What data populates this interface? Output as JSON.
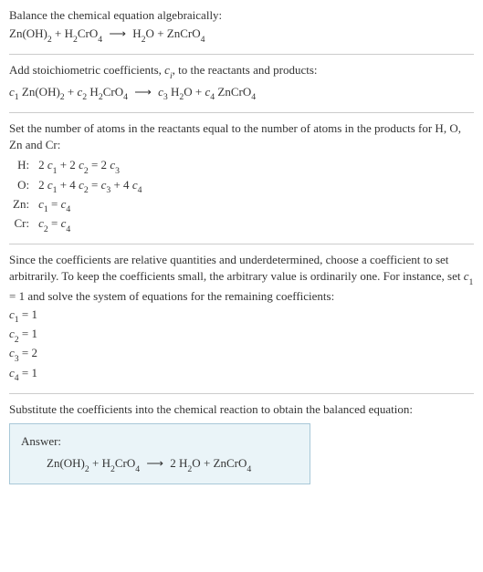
{
  "section1": {
    "heading": "Balance the chemical equation algebraically:",
    "lhs1": "Zn(OH)",
    "lhs1_sub": "2",
    "plus": " + ",
    "lhs2a": "H",
    "lhs2a_sub": "2",
    "lhs2b": "CrO",
    "lhs2b_sub": "4",
    "arrow": "⟶",
    "rhs1a": "H",
    "rhs1a_sub": "2",
    "rhs1b": "O",
    "plus2": " + ",
    "rhs2a": "ZnCrO",
    "rhs2a_sub": "4"
  },
  "section2": {
    "heading_a": "Add stoichiometric coefficients, ",
    "heading_c": "c",
    "heading_i": "i",
    "heading_b": ", to the reactants and products:",
    "c1": "c",
    "s1": "1",
    "sp1": " Zn(OH)",
    "sp1_sub": "2",
    "plus": " + ",
    "c2": "c",
    "s2": "2",
    "sp2a": " H",
    "sp2a_sub": "2",
    "sp2b": "CrO",
    "sp2b_sub": "4",
    "arrow": "⟶",
    "c3": "c",
    "s3": "3",
    "sp3a": " H",
    "sp3a_sub": "2",
    "sp3b": "O",
    "plus2": " + ",
    "c4": "c",
    "s4": "4",
    "sp4a": " ZnCrO",
    "sp4a_sub": "4"
  },
  "section3": {
    "heading": "Set the number of atoms in the reactants equal to the number of atoms in the products for H, O, Zn and Cr:",
    "rows": {
      "h_label": "H:",
      "h_eq_a": "2 ",
      "h_c1": "c",
      "h_s1": "1",
      "h_eq_b": " + 2 ",
      "h_c2": "c",
      "h_s2": "2",
      "h_eq_c": " = 2 ",
      "h_c3": "c",
      "h_s3": "3",
      "o_label": "O:",
      "o_eq_a": "2 ",
      "o_c1": "c",
      "o_s1": "1",
      "o_eq_b": " + 4 ",
      "o_c2": "c",
      "o_s2": "2",
      "o_eq_c": " = ",
      "o_c3": "c",
      "o_s3": "3",
      "o_eq_d": " + 4 ",
      "o_c4": "c",
      "o_s4": "4",
      "zn_label": "Zn:",
      "zn_c1": "c",
      "zn_s1": "1",
      "zn_eq": " = ",
      "zn_c4": "c",
      "zn_s4": "4",
      "cr_label": "Cr:",
      "cr_c2": "c",
      "cr_s2": "2",
      "cr_eq": " = ",
      "cr_c4": "c",
      "cr_s4": "4"
    }
  },
  "section4": {
    "text_a": "Since the coefficients are relative quantities and underdetermined, choose a coefficient to set arbitrarily. To keep the coefficients small, the arbitrary value is ordinarily one. For instance, set ",
    "c1": "c",
    "s1": "1",
    "text_b": " = 1 and solve the system of equations for the remaining coefficients:",
    "l1a": "c",
    "l1s": "1",
    "l1b": " = 1",
    "l2a": "c",
    "l2s": "2",
    "l2b": " = 1",
    "l3a": "c",
    "l3s": "3",
    "l3b": " = 2",
    "l4a": "c",
    "l4s": "4",
    "l4b": " = 1"
  },
  "section5": {
    "heading": "Substitute the coefficients into the chemical reaction to obtain the balanced equation:",
    "answer_label": "Answer:",
    "lhs1": "Zn(OH)",
    "lhs1_sub": "2",
    "plus": " + ",
    "lhs2a": "H",
    "lhs2a_sub": "2",
    "lhs2b": "CrO",
    "lhs2b_sub": "4",
    "arrow": "⟶",
    "rhs_pre": " 2 ",
    "rhs1a": "H",
    "rhs1a_sub": "2",
    "rhs1b": "O",
    "plus2": " + ",
    "rhs2a": "ZnCrO",
    "rhs2a_sub": "4"
  }
}
